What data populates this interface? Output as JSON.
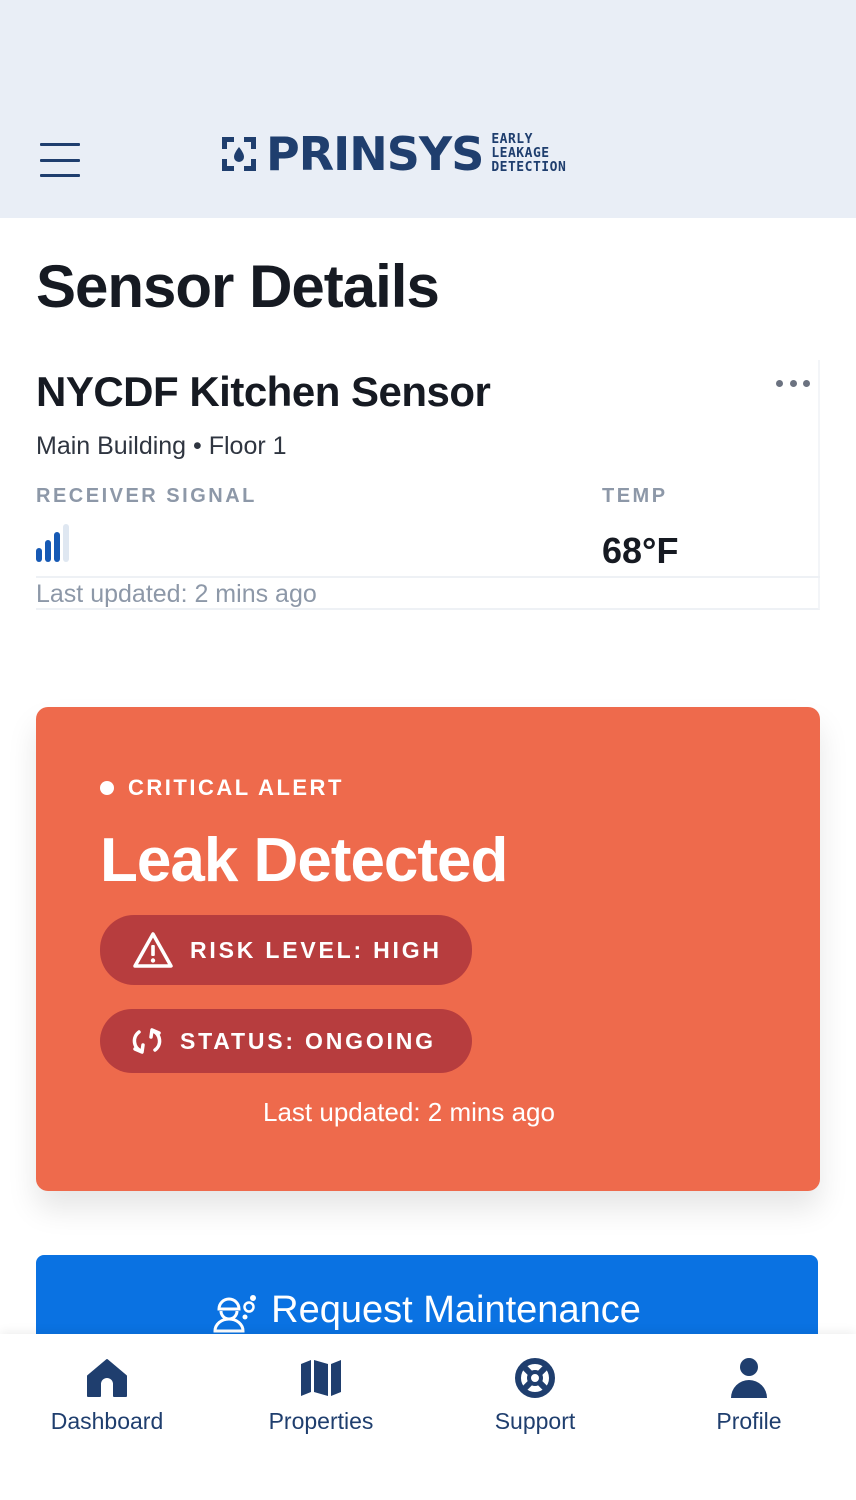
{
  "header": {
    "logo_text": "PRINSYS",
    "logo_tagline": [
      "EARLY",
      "LEAKAGE",
      "DETECTION"
    ]
  },
  "page": {
    "title": "Sensor Details"
  },
  "sensor": {
    "name": "NYCDF Kitchen Sensor",
    "location": "Main Building • Floor 1",
    "signal_label": "RECEIVER SIGNAL",
    "signal_bars_active": 3,
    "signal_bars_total": 4,
    "temp_label": "TEMP",
    "temp_value": "68°F",
    "last_updated": "Last updated: 2 mins ago"
  },
  "alert": {
    "tag": "CRITICAL ALERT",
    "title": "Leak Detected",
    "risk": "RISK LEVEL: HIGH",
    "status": "STATUS: ONGOING",
    "last_updated": "Last updated: 2 mins ago"
  },
  "actions": {
    "maintenance_label": "Request Maintenance"
  },
  "nav": {
    "items": [
      {
        "label": "Dashboard",
        "icon": "home-icon"
      },
      {
        "label": "Properties",
        "icon": "map-icon"
      },
      {
        "label": "Support",
        "icon": "lifebuoy-icon"
      },
      {
        "label": "Profile",
        "icon": "user-icon"
      }
    ]
  },
  "colors": {
    "brand": "#1f3e6e",
    "alert_bg": "#ee6a4c",
    "alert_pill": "#b73d3e",
    "primary_button": "#0a72e2",
    "signal_active": "#1659b4",
    "signal_inactive": "#dfe7f1"
  }
}
